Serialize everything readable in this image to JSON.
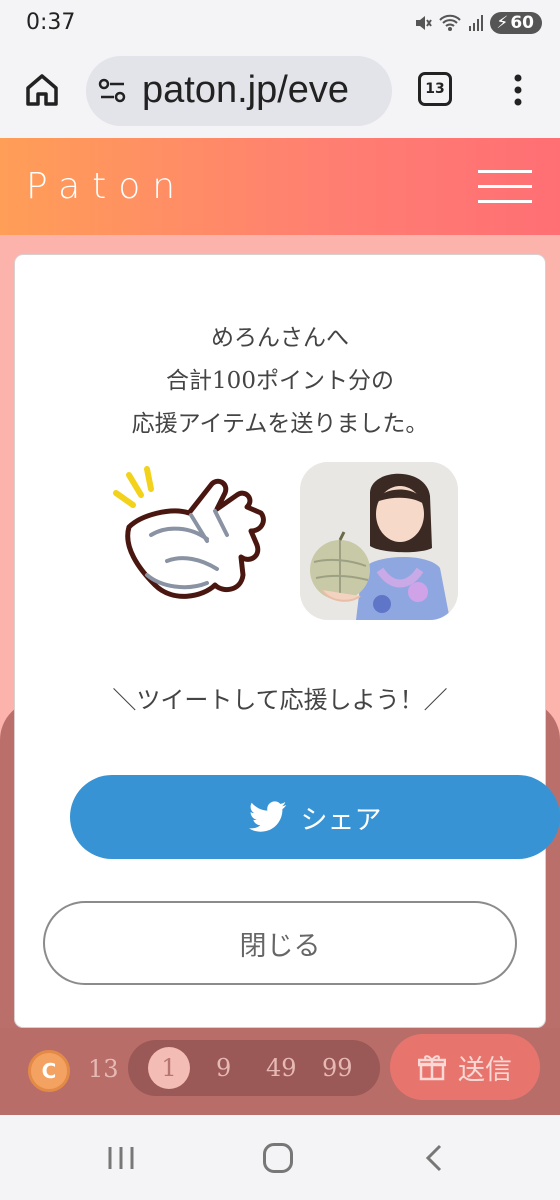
{
  "status_bar": {
    "time": "0:37",
    "battery": "60"
  },
  "browser": {
    "url": "paton.jp/eve",
    "tab_count": "13"
  },
  "site": {
    "logo": "Paton"
  },
  "modal": {
    "message_line1": "めろんさんへ",
    "message_line2": "合計100ポイント分の",
    "message_line3": "応援アイテムを送りました。",
    "tweet_prompt": "＼ツイートして応援しよう！／",
    "share_label": "シェア",
    "close_label": "閉じる"
  },
  "bottom_bar": {
    "coin_symbol": "C",
    "coin_count": "13",
    "amounts": [
      "1",
      "9",
      "49",
      "99"
    ],
    "selected_amount": "1",
    "send_label": "送信"
  },
  "colors": {
    "header_start": "#ff9e57",
    "header_end": "#ff6f74",
    "twitter_blue": "#3793d3"
  },
  "icons": [
    "home-icon",
    "tune-icon",
    "more-vert-icon",
    "menu-icon",
    "clap-icon",
    "twitter-bird-icon",
    "gift-icon"
  ]
}
